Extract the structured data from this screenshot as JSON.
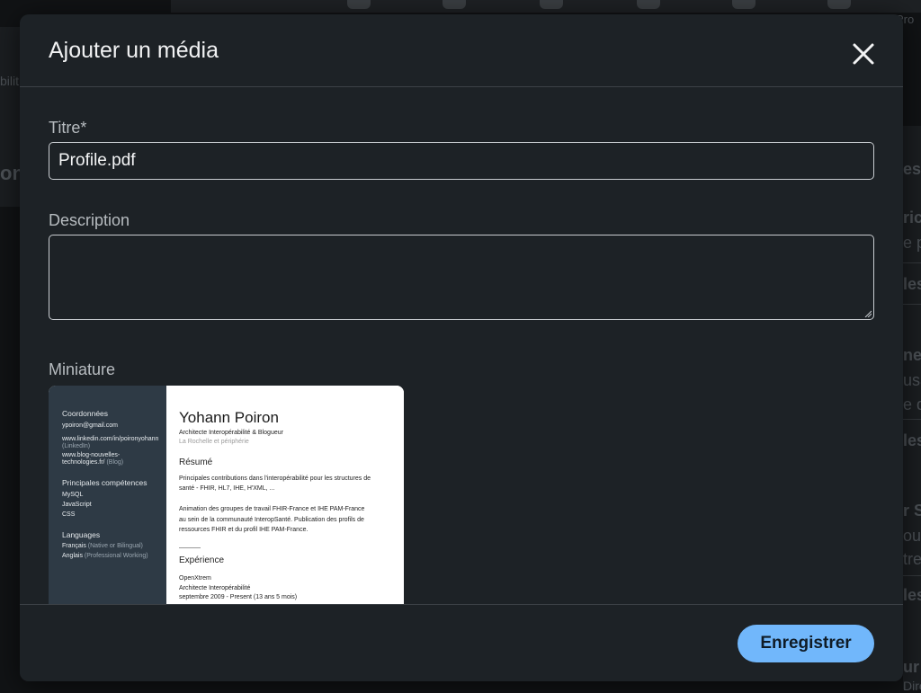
{
  "background": {
    "left_fragment_1": "bilit",
    "left_fragment_2": "on",
    "right_fragments": [
      "es",
      "ric",
      "e p",
      "les",
      "ne",
      "usa",
      "e d",
      "les",
      "r S",
      "our",
      "tre",
      "les",
      "ur",
      "Directeur"
    ],
    "top_right_fragment": "Pro"
  },
  "modal": {
    "title": "Ajouter un média",
    "close_icon": "close-icon",
    "title_field": {
      "label": "Titre*",
      "value": "Profile.pdf"
    },
    "description_field": {
      "label": "Description",
      "value": ""
    },
    "thumbnail": {
      "label": "Miniature",
      "sidebar": {
        "contact_heading": "Coordonnées",
        "email": "ypoiron@gmail.com",
        "linkedin_url": "www.linkedin.com/in/poironyohann",
        "linkedin_tag": "(LinkedIn)",
        "blog_url_1": "www.blog-nouvelles-",
        "blog_url_2": "technologies.fr/",
        "blog_tag": "(Blog)",
        "skills_heading": "Principales compétences",
        "skills": [
          "MySQL",
          "JavaScript",
          "CSS"
        ],
        "languages_heading": "Languages",
        "lang_1": "Français",
        "lang_1_level": "(Native or Bilingual)",
        "lang_2": "Anglais",
        "lang_2_level": "(Professional Working)"
      },
      "main": {
        "name": "Yohann Poiron",
        "headline": "Architecte Interopérabilité & Blogueur",
        "location": "La Rochelle et périphérie",
        "summary_heading": "Résumé",
        "summary_1a": "Principales contributions dans l'interopérabilité pour les structures de",
        "summary_1b": "santé - FHIR, HL7, IHE, H'XML, ...",
        "summary_2a": "Animation des groupes de travail FHIR-France et IHE PAM-France",
        "summary_2b": "au sein de la communauté InteropSanté. Publication des profils de",
        "summary_2c": "ressources FHIR et du profil IHE PAM-France.",
        "experience_heading": "Expérience",
        "company": "OpenXtrem",
        "job_title": "Architecte Interopérabilité",
        "job_dates": "septembre 2009 - Present (13 ans 5 mois)"
      }
    },
    "save_label": "Enregistrer"
  },
  "colors": {
    "modal_bg": "#1d2226",
    "accent_button": "#71b7fb",
    "thumb_sidebar": "#2e3a45"
  }
}
